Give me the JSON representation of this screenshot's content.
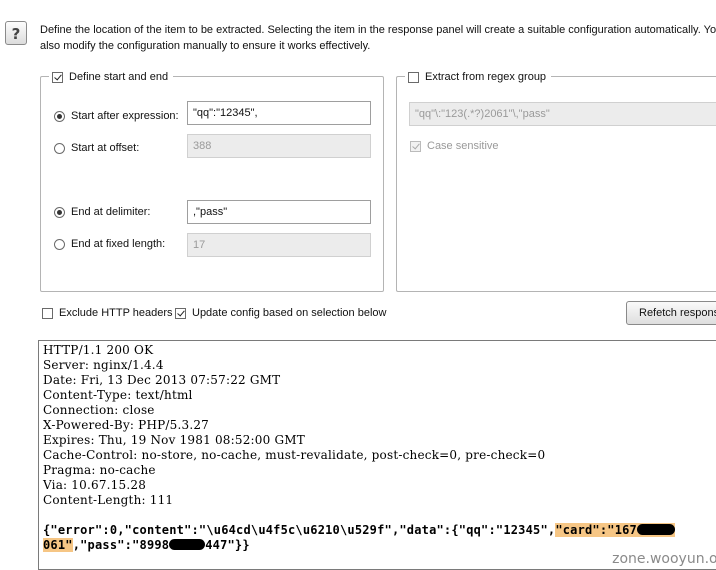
{
  "help_glyph": "?",
  "intro": {
    "line1": "Define the location of the item to be extracted. Selecting the item in the response panel will create a suitable configuration automatically. You",
    "line2": "also modify the configuration manually to ensure it works effectively."
  },
  "define_group": {
    "label": "Define start and end",
    "checked": true,
    "start_after_label": "Start after expression:",
    "start_after_value": "\"qq\":\"12345\",",
    "start_offset_label": "Start at offset:",
    "start_offset_value": "388",
    "end_delim_label": "End at delimiter:",
    "end_delim_value": ",\"pass\"",
    "end_fixed_label": "End at fixed length:",
    "end_fixed_value": "17"
  },
  "regex_group": {
    "label": "Extract from regex group",
    "checked": false,
    "regex_value": "\"qq\"\\:\"123(.*?)2061\"\\,\"pass\"",
    "case_label": "Case sensitive",
    "case_checked": true
  },
  "options": {
    "exclude_headers_label": "Exclude HTTP headers",
    "exclude_headers_checked": false,
    "update_config_label": "Update config based on selection below",
    "update_config_checked": true,
    "refetch_label": "Refetch respons"
  },
  "response": {
    "headers": [
      "HTTP/1.1 200 OK",
      "Server: nginx/1.4.4",
      "Date: Fri, 13 Dec 2013 07:57:22 GMT",
      "Content-Type: text/html",
      "Connection: close",
      "X-Powered-By: PHP/5.3.27",
      "Expires: Thu, 19 Nov 1981 08:52:00 GMT",
      "Cache-Control: no-store, no-cache, must-revalidate, post-check=0, pre-check=0",
      "Pragma: no-cache",
      "Via: 10.67.15.28",
      "Content-Length: 111"
    ],
    "json_part1": "{\"error\":0,\"content\":\"\\u64cd\\u4f5c\\u6210\\u529f\",\"data\":{\"qq\":\"12345\",",
    "json_hl1": "\"card\":\"167",
    "json_hl2": "061\"",
    "json_part2": ",\"pass\":\"8998",
    "json_part3": "447\"}}"
  },
  "watermark": "zone.wooyun.org"
}
